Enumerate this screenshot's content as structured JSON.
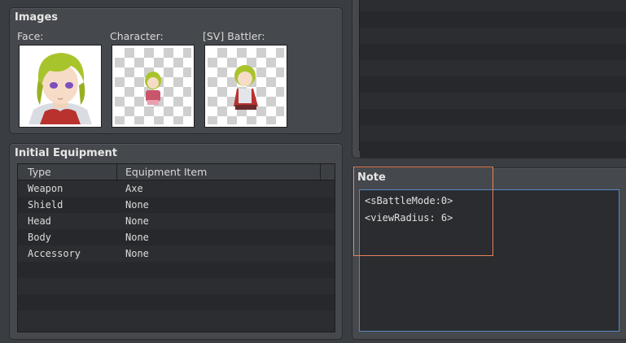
{
  "images": {
    "title": "Images",
    "face_label": "Face:",
    "character_label": "Character:",
    "battler_label": "[SV] Battler:"
  },
  "equipment": {
    "title": "Initial Equipment",
    "columns": [
      "Type",
      "Equipment Item"
    ],
    "rows": [
      {
        "type": "Weapon",
        "item": "Axe"
      },
      {
        "type": "Shield",
        "item": "None"
      },
      {
        "type": "Head",
        "item": "None"
      },
      {
        "type": "Body",
        "item": "None"
      },
      {
        "type": "Accessory",
        "item": "None"
      }
    ]
  },
  "note": {
    "title": "Note",
    "lines": [
      "<sBattleMode:0>",
      "<viewRadius: 6>"
    ]
  },
  "colors": {
    "highlight": "#e8845e",
    "note_border": "#5a86c5"
  }
}
